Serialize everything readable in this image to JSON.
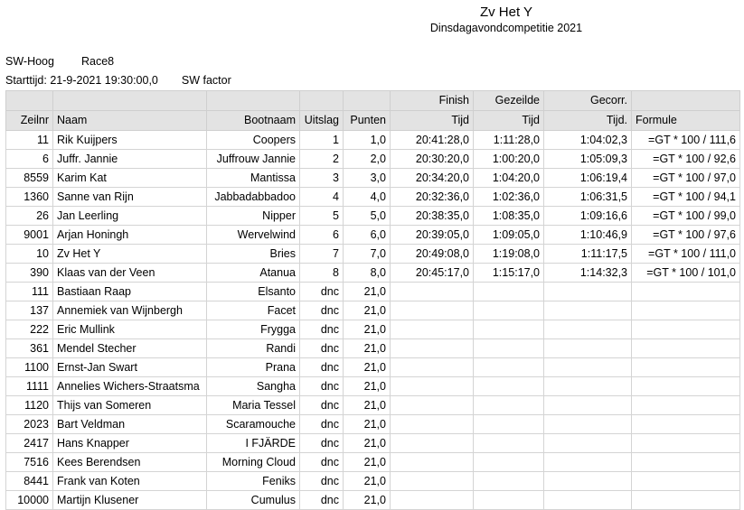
{
  "document": {
    "title": "Zv Het Y",
    "subtitle": "Dinsdagavondcompetitie 2021"
  },
  "meta": {
    "class_label": "SW-Hoog",
    "race_label": "Race8",
    "start_time_label": "Starttijd: 21-9-2021  19:30:00,0",
    "sw_factor_label": "SW factor"
  },
  "table": {
    "header_top": [
      "",
      "",
      "",
      "",
      "",
      "Finish",
      "Gezeilde",
      "Gecorr.",
      ""
    ],
    "header_bottom": [
      "Zeilnr",
      "Naam",
      "Bootnaam",
      "Uitslag",
      "Punten",
      "Tijd",
      "Tijd",
      "Tijd.",
      "Formule"
    ],
    "rows": [
      {
        "zeilnr": "11",
        "naam": "Rik Kuijpers",
        "bootnaam": "Coopers",
        "uitslag": "1",
        "punten": "1,0",
        "finish_tijd": "20:41:28,0",
        "gezeilde_tijd": "1:11:28,0",
        "gecorr_tijd": "1:04:02,3",
        "formule": "=GT * 100 / 111,6"
      },
      {
        "zeilnr": "6",
        "naam": "Juffr. Jannie",
        "bootnaam": "Juffrouw Jannie",
        "uitslag": "2",
        "punten": "2,0",
        "finish_tijd": "20:30:20,0",
        "gezeilde_tijd": "1:00:20,0",
        "gecorr_tijd": "1:05:09,3",
        "formule": "=GT * 100 / 92,6"
      },
      {
        "zeilnr": "8559",
        "naam": "Karim Kat",
        "bootnaam": "Mantissa",
        "uitslag": "3",
        "punten": "3,0",
        "finish_tijd": "20:34:20,0",
        "gezeilde_tijd": "1:04:20,0",
        "gecorr_tijd": "1:06:19,4",
        "formule": "=GT * 100 / 97,0"
      },
      {
        "zeilnr": "1360",
        "naam": "Sanne van Rijn",
        "bootnaam": "Jabbadabbadoo",
        "uitslag": "4",
        "punten": "4,0",
        "finish_tijd": "20:32:36,0",
        "gezeilde_tijd": "1:02:36,0",
        "gecorr_tijd": "1:06:31,5",
        "formule": "=GT * 100 / 94,1"
      },
      {
        "zeilnr": "26",
        "naam": "Jan Leerling",
        "bootnaam": "Nipper",
        "uitslag": "5",
        "punten": "5,0",
        "finish_tijd": "20:38:35,0",
        "gezeilde_tijd": "1:08:35,0",
        "gecorr_tijd": "1:09:16,6",
        "formule": "=GT * 100 / 99,0"
      },
      {
        "zeilnr": "9001",
        "naam": "Arjan Honingh",
        "bootnaam": "Wervelwind",
        "uitslag": "6",
        "punten": "6,0",
        "finish_tijd": "20:39:05,0",
        "gezeilde_tijd": "1:09:05,0",
        "gecorr_tijd": "1:10:46,9",
        "formule": "=GT * 100 / 97,6"
      },
      {
        "zeilnr": "10",
        "naam": "Zv Het Y",
        "bootnaam": "Bries",
        "uitslag": "7",
        "punten": "7,0",
        "finish_tijd": "20:49:08,0",
        "gezeilde_tijd": "1:19:08,0",
        "gecorr_tijd": "1:11:17,5",
        "formule": "=GT * 100 / 111,0"
      },
      {
        "zeilnr": "390",
        "naam": "Klaas van der Veen",
        "bootnaam": "Atanua",
        "uitslag": "8",
        "punten": "8,0",
        "finish_tijd": "20:45:17,0",
        "gezeilde_tijd": "1:15:17,0",
        "gecorr_tijd": "1:14:32,3",
        "formule": "=GT * 100 / 101,0"
      },
      {
        "zeilnr": "111",
        "naam": "Bastiaan Raap",
        "bootnaam": "Elsanto",
        "uitslag": "dnc",
        "punten": "21,0",
        "finish_tijd": "",
        "gezeilde_tijd": "",
        "gecorr_tijd": "",
        "formule": ""
      },
      {
        "zeilnr": "137",
        "naam": "Annemiek van Wijnbergh",
        "bootnaam": "Facet",
        "uitslag": "dnc",
        "punten": "21,0",
        "finish_tijd": "",
        "gezeilde_tijd": "",
        "gecorr_tijd": "",
        "formule": ""
      },
      {
        "zeilnr": "222",
        "naam": "Eric Mullink",
        "bootnaam": "Frygga",
        "uitslag": "dnc",
        "punten": "21,0",
        "finish_tijd": "",
        "gezeilde_tijd": "",
        "gecorr_tijd": "",
        "formule": ""
      },
      {
        "zeilnr": "361",
        "naam": "Mendel Stecher",
        "bootnaam": "Randi",
        "uitslag": "dnc",
        "punten": "21,0",
        "finish_tijd": "",
        "gezeilde_tijd": "",
        "gecorr_tijd": "",
        "formule": ""
      },
      {
        "zeilnr": "1100",
        "naam": "Ernst-Jan Swart",
        "bootnaam": "Prana",
        "uitslag": "dnc",
        "punten": "21,0",
        "finish_tijd": "",
        "gezeilde_tijd": "",
        "gecorr_tijd": "",
        "formule": ""
      },
      {
        "zeilnr": "1111",
        "naam": "Annelies Wichers-Straatsma",
        "bootnaam": "Sangha",
        "uitslag": "dnc",
        "punten": "21,0",
        "finish_tijd": "",
        "gezeilde_tijd": "",
        "gecorr_tijd": "",
        "formule": ""
      },
      {
        "zeilnr": "1120",
        "naam": "Thijs van Someren",
        "bootnaam": "Maria Tessel",
        "uitslag": "dnc",
        "punten": "21,0",
        "finish_tijd": "",
        "gezeilde_tijd": "",
        "gecorr_tijd": "",
        "formule": ""
      },
      {
        "zeilnr": "2023",
        "naam": "Bart Veldman",
        "bootnaam": "Scaramouche",
        "uitslag": "dnc",
        "punten": "21,0",
        "finish_tijd": "",
        "gezeilde_tijd": "",
        "gecorr_tijd": "",
        "formule": ""
      },
      {
        "zeilnr": "2417",
        "naam": "Hans Knapper",
        "bootnaam": "I FJÄRDE",
        "uitslag": "dnc",
        "punten": "21,0",
        "finish_tijd": "",
        "gezeilde_tijd": "",
        "gecorr_tijd": "",
        "formule": ""
      },
      {
        "zeilnr": "7516",
        "naam": "Kees Berendsen",
        "bootnaam": "Morning Cloud",
        "uitslag": "dnc",
        "punten": "21,0",
        "finish_tijd": "",
        "gezeilde_tijd": "",
        "gecorr_tijd": "",
        "formule": ""
      },
      {
        "zeilnr": "8441",
        "naam": "Frank van Koten",
        "bootnaam": "Feniks",
        "uitslag": "dnc",
        "punten": "21,0",
        "finish_tijd": "",
        "gezeilde_tijd": "",
        "gecorr_tijd": "",
        "formule": ""
      },
      {
        "zeilnr": "10000",
        "naam": "Martijn Klusener",
        "bootnaam": "Cumulus",
        "uitslag": "dnc",
        "punten": "21,0",
        "finish_tijd": "",
        "gezeilde_tijd": "",
        "gecorr_tijd": "",
        "formule": ""
      }
    ]
  },
  "colors": {
    "header_background": "#e3e3e3",
    "grid_line": "#d4d4d4",
    "text": "#000000",
    "page_background": "#ffffff"
  }
}
